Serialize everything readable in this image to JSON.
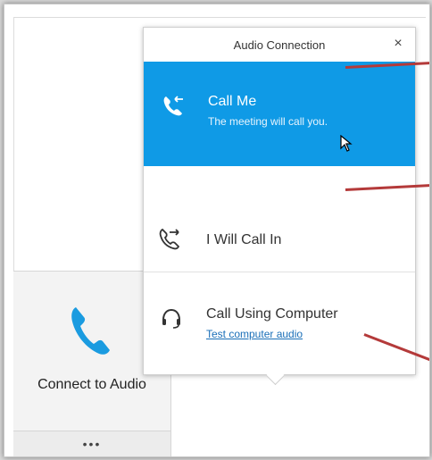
{
  "popup": {
    "title": "Audio Connection",
    "close_symbol": "×",
    "options": [
      {
        "title": "Call Me",
        "subtitle": "The meeting will call you.",
        "icon": "phone-incoming-icon",
        "selected": true
      },
      {
        "title": "I Will Call In",
        "icon": "phone-outgoing-icon",
        "selected": false
      },
      {
        "title": "Call Using Computer",
        "link": "Test computer audio",
        "icon": "headset-icon",
        "selected": false
      }
    ]
  },
  "tile": {
    "label": "Connect to Audio",
    "more": "•••",
    "icon": "phone-icon"
  },
  "colors": {
    "accent": "#0f9ae6",
    "annotation": "#b43a3a",
    "link": "#1a6fb8"
  }
}
